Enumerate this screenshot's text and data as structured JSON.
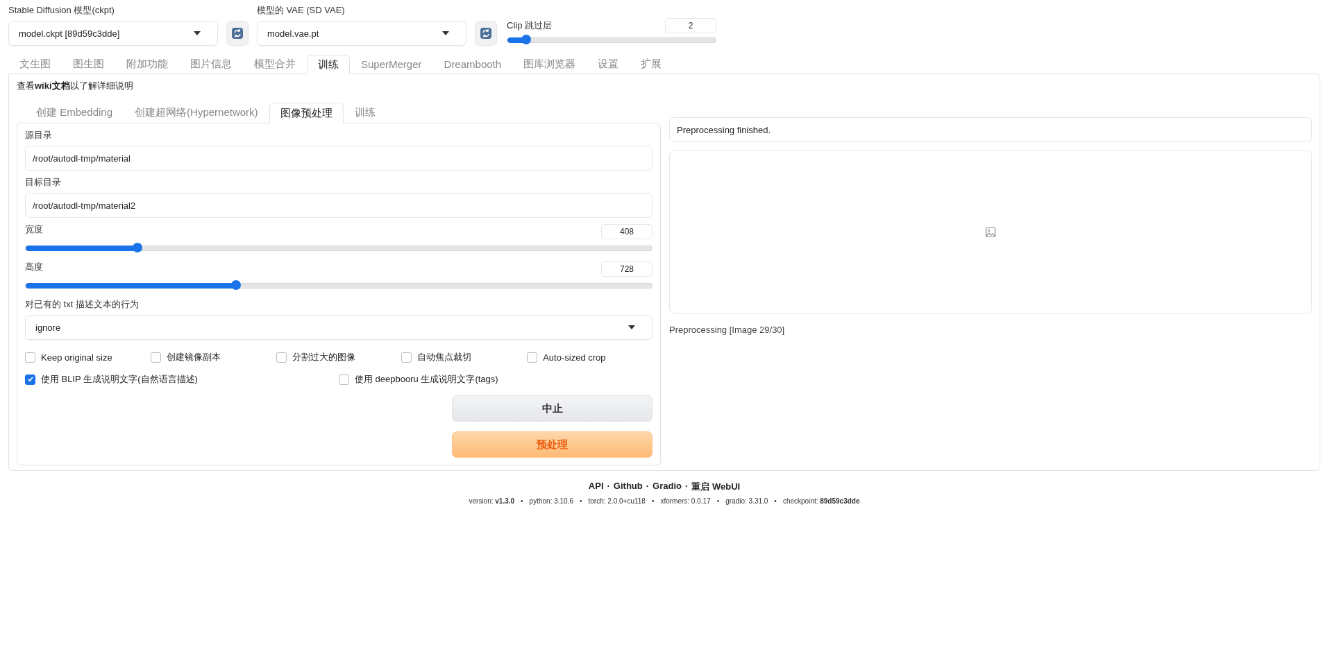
{
  "top_controls": {
    "checkpoint": {
      "label": "Stable Diffusion 模型(ckpt)",
      "value": "model.ckpt [89d59c3dde]"
    },
    "vae": {
      "label": "模型的 VAE (SD VAE)",
      "value": "model.vae.pt"
    },
    "clip_skip": {
      "label": "Clip 跳过层",
      "value": "2",
      "level": 0.09
    }
  },
  "tabs": [
    {
      "label": "文生图",
      "selected": false
    },
    {
      "label": "图生图",
      "selected": false
    },
    {
      "label": "附加功能",
      "selected": false
    },
    {
      "label": "图片信息",
      "selected": false
    },
    {
      "label": "模型合并",
      "selected": false
    },
    {
      "label": "训练",
      "selected": true
    },
    {
      "label": "SuperMerger",
      "selected": false
    },
    {
      "label": "Dreambooth",
      "selected": false
    },
    {
      "label": "图库浏览器",
      "selected": false
    },
    {
      "label": "设置",
      "selected": false
    },
    {
      "label": "扩展",
      "selected": false
    }
  ],
  "wiki_note": "查看**wiki文档**以了解详细说明",
  "subtabs": [
    {
      "label": "创建 Embedding",
      "selected": false
    },
    {
      "label": "创建超网络(Hypernetwork)",
      "selected": false
    },
    {
      "label": "图像预处理",
      "selected": true
    },
    {
      "label": "训练",
      "selected": false
    }
  ],
  "form": {
    "fields": [
      {
        "label": "源目录",
        "value": "/root/autodl-tmp/material"
      },
      {
        "label": "目标目录",
        "value": "/root/autodl-tmp/material2"
      }
    ],
    "sliders": [
      {
        "label": "宽度",
        "value": "408",
        "level": 0.178
      },
      {
        "label": "高度",
        "value": "728",
        "level": 0.336
      }
    ],
    "dropdown": {
      "label": "对已有的 txt 描述文本的行为",
      "value": "ignore"
    },
    "checkbox_rows": [
      [
        {
          "label": "Keep original size",
          "checked": false
        },
        {
          "label": "创建镜像副本",
          "checked": false
        },
        {
          "label": "分割过大的图像",
          "checked": false
        },
        {
          "label": "自动焦点裁切",
          "checked": false
        },
        {
          "label": "Auto-sized crop",
          "checked": false
        }
      ],
      [
        {
          "label": "使用 BLIP 生成说明文字(自然语言描述)",
          "checked": true
        },
        {
          "label": "使用 deepbooru 生成说明文字(tags)",
          "checked": false
        }
      ]
    ],
    "buttons": [
      {
        "label": "中止",
        "kind": "secondary"
      },
      {
        "label": "预处理",
        "kind": "primary"
      }
    ]
  },
  "output": {
    "message": "Preprocessing finished.",
    "progress": "Preprocessing [Image 29/30]"
  },
  "footer": {
    "link_separator": "·",
    "version_separator": "•",
    "links": [
      "API",
      "Github",
      "Gradio",
      "重启 WebUI"
    ],
    "versions": [
      "version: **v1.3.0**",
      "python: 3.10.6",
      "torch: 2.0.0+cu118",
      "xformers: 0.0.17",
      "gradio: 3.31.0",
      "checkpoint: **89d59c3dde**"
    ]
  }
}
